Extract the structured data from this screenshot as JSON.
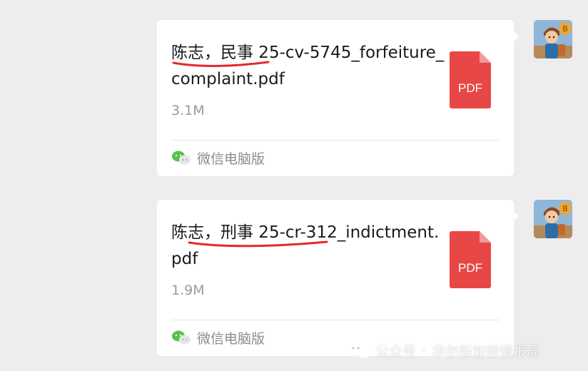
{
  "messages": [
    {
      "file_name": "陈志，民事 25-cv-5745_forfeiture_complaint.pdf",
      "file_size": "3.1M",
      "file_type_label": "PDF",
      "source_label": "微信电脑版",
      "annotation": "red-underline"
    },
    {
      "file_name": "陈志，刑事 25-cr-312_indictment.pdf",
      "file_size": "1.9M",
      "file_type_label": "PDF",
      "source_label": "微信电脑版",
      "annotation": "red-underline"
    }
  ],
  "watermark": {
    "prefix": "公众号",
    "separator": "·",
    "account": "华尔街加密情报局"
  },
  "icons": {
    "file": "pdf-file-icon",
    "source": "wechat-icon",
    "avatar": "cartoon-boy-bitcoin-avatar"
  },
  "colors": {
    "background": "#ededed",
    "bubble": "#ffffff",
    "pdf": "#e84747",
    "underline": "#e5282c",
    "wechat_green": "#55c34a"
  }
}
